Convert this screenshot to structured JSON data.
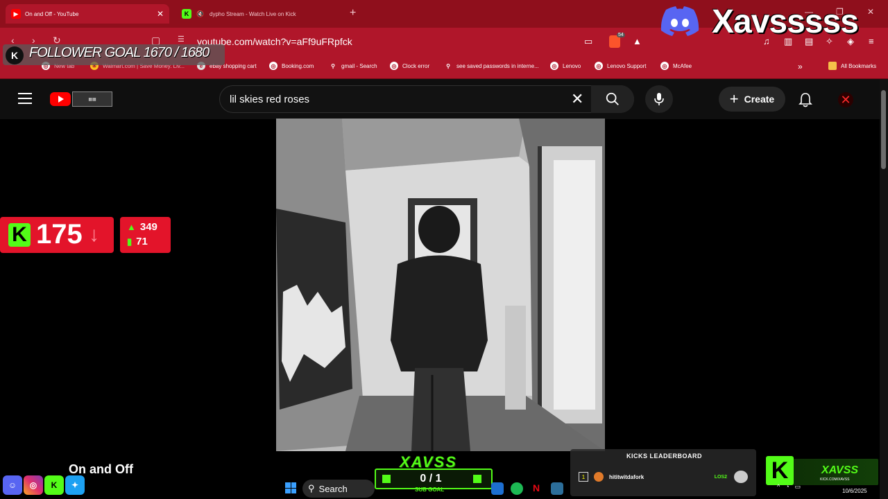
{
  "browser": {
    "tabs": [
      {
        "title": "On and Off - YouTube",
        "active": true
      },
      {
        "title": "dypho Stream - Watch Live on Kick",
        "active": false
      }
    ],
    "url": "youtube.com/watch?v=aFf9uFRpfck",
    "shield_badge": "54",
    "bookmarks": [
      "New tab",
      "Walmart.com | Save Money. Liv...",
      "ebay shopping cart",
      "Booking.com",
      "gmail - Search",
      "Clock error",
      "see saved passwords in interne...",
      "Lenovo",
      "Lenovo Support",
      "McAfee"
    ],
    "all_bookmarks": "All Bookmarks"
  },
  "youtube": {
    "search_query": "lil skies red roses",
    "create_label": "Create",
    "video_title": "On and Off"
  },
  "overlay": {
    "streamer_name": "Xavsssss",
    "follower_goal": "FOLLOWER GOAL 1670 / 1680",
    "viewer_count": "175",
    "stat_followers": "349",
    "stat_second": "71",
    "leaderboard": {
      "title": "KICKS LEADERBOARD",
      "rows": [
        {
          "rank": "1",
          "name": "hititwitdafork",
          "amount": "LOS2"
        }
      ]
    },
    "subgoal_logo": "XAVSS",
    "subgoal_value": "0 / 1",
    "subgoal_label": "SUB GOAL",
    "kick_name": "XAVSS",
    "kick_url": "KICK.COM/XAVSS"
  },
  "taskbar": {
    "search_label": "Search",
    "date": "10/6/2025"
  },
  "colors": {
    "browser_red": "#b0162a",
    "kick_green": "#53fc18",
    "yt_bg": "#0f0f0f"
  }
}
